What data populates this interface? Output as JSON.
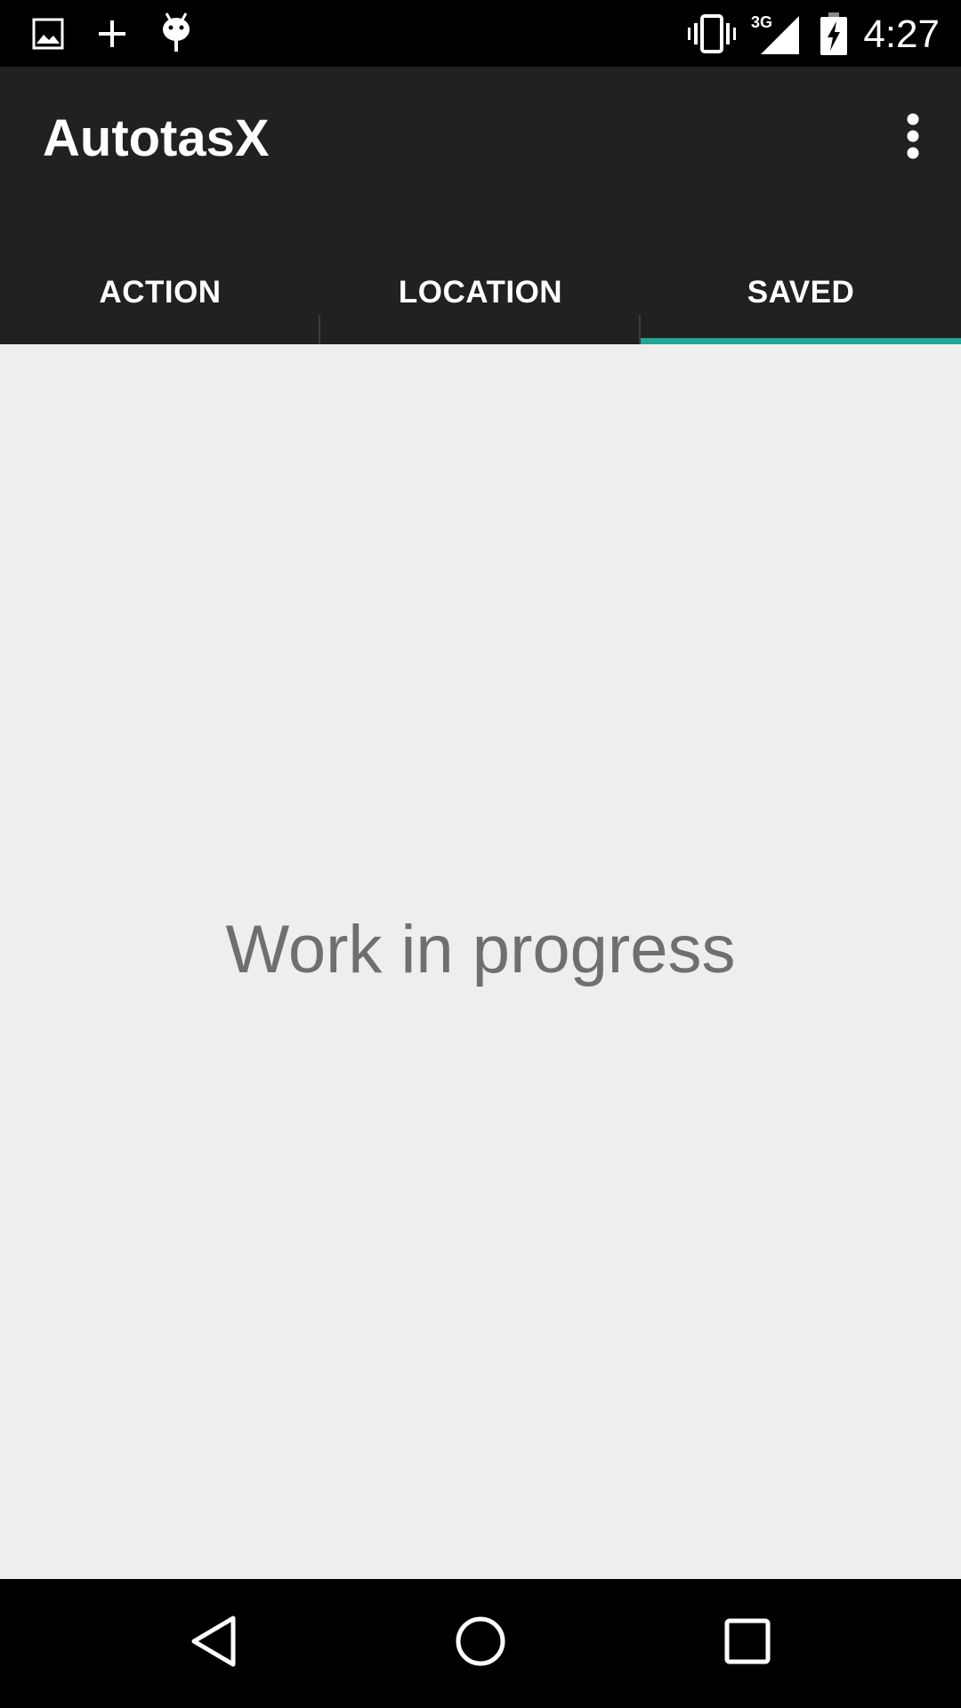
{
  "status_bar": {
    "time": "4:27",
    "network_label": "3G",
    "left_icons": [
      "image-icon",
      "plus-icon",
      "android-icon"
    ],
    "right_icons": [
      "vibrate-icon",
      "signal-icon",
      "battery-charging-icon"
    ]
  },
  "app_bar": {
    "title": "AutotasX",
    "overflow_icon": "more-vert-icon"
  },
  "tabs": [
    {
      "label": "ACTION",
      "selected": false
    },
    {
      "label": "LOCATION",
      "selected": false
    },
    {
      "label": "SAVED",
      "selected": true
    }
  ],
  "main": {
    "message": "Work in progress"
  },
  "nav_bar": {
    "icons": [
      "back-icon",
      "home-icon",
      "recents-icon"
    ]
  },
  "colors": {
    "status_bar": "#000000",
    "app_bar": "#212121",
    "tab_indicator": "#1fa595",
    "content_bg": "#eeeeee",
    "message_text": "#6f6f6f"
  }
}
